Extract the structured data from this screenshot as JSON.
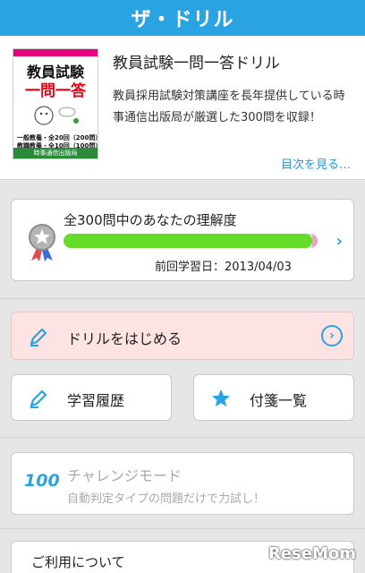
{
  "header": {
    "app_title": "ザ・ドリル"
  },
  "book": {
    "cover": {
      "title_line1": "教員試験",
      "title_line2": "一問一答",
      "line_a": "一般教養・全20回（200問）",
      "line_b": "教職教養・全10回（100問）",
      "publisher": "時事通信出版局"
    },
    "title": "教員試験一問一答ドリル",
    "description": "教員採用試験対策講座を長年提供している時事通信出版局が厳選した300問を収録！",
    "toc_link": "目次を見る…"
  },
  "progress": {
    "title": "全300問中のあなたの理解度",
    "fill_percent": 98,
    "last_study": "前回学習日：2013/04/03"
  },
  "menu": {
    "start_label": "ドリルをはじめる",
    "history_label": "学習履歴",
    "favorites_label": "付箋一覧",
    "challenge_title": "チャレンジモード",
    "challenge_sub": "自動判定タイプの問題だけで力試し！",
    "challenge_icon_text": "100",
    "terms_label": "ご利用について"
  },
  "watermark": "ReseMom",
  "colors": {
    "header": "#2aa3e3",
    "accent": "#2aa3e3",
    "progress": "#64dc28",
    "start_bg": "#fde3e3"
  }
}
